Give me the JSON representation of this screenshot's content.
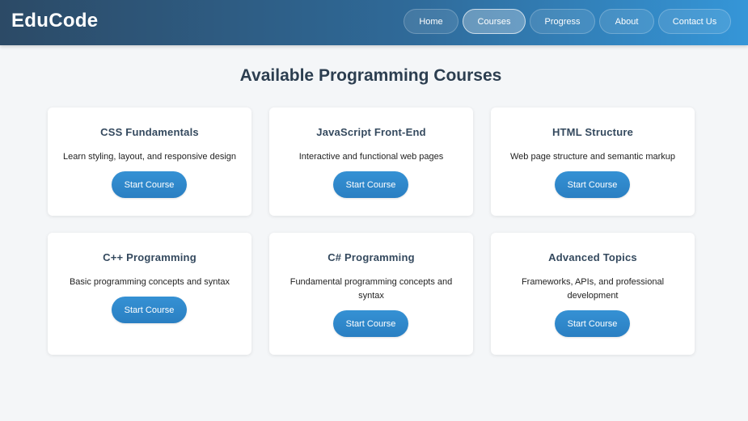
{
  "header": {
    "logo": "EduCode",
    "nav": [
      {
        "label": "Home",
        "active": false
      },
      {
        "label": "Courses",
        "active": true
      },
      {
        "label": "Progress",
        "active": false
      },
      {
        "label": "About",
        "active": false
      },
      {
        "label": "Contact Us",
        "active": false
      }
    ]
  },
  "main": {
    "title": "Available Programming Courses",
    "courses": [
      {
        "title": "CSS Fundamentals",
        "description": "Learn styling, layout, and responsive design",
        "button": "Start Course"
      },
      {
        "title": "JavaScript Front-End",
        "description": "Interactive and functional web pages",
        "button": "Start Course"
      },
      {
        "title": "HTML Structure",
        "description": "Web page structure and semantic markup",
        "button": "Start Course"
      },
      {
        "title": "C++ Programming",
        "description": "Basic programming concepts and syntax",
        "button": "Start Course"
      },
      {
        "title": "C# Programming",
        "description": "Fundamental programming concepts and syntax",
        "button": "Start Course"
      },
      {
        "title": "Advanced Topics",
        "description": "Frameworks, APIs, and professional development",
        "button": "Start Course"
      }
    ]
  },
  "colors": {
    "header_start": "#2c4a66",
    "header_end": "#3596d8",
    "accent_button": "#2f89cc",
    "background": "#f4f6f8",
    "title_text": "#2c3e50"
  }
}
